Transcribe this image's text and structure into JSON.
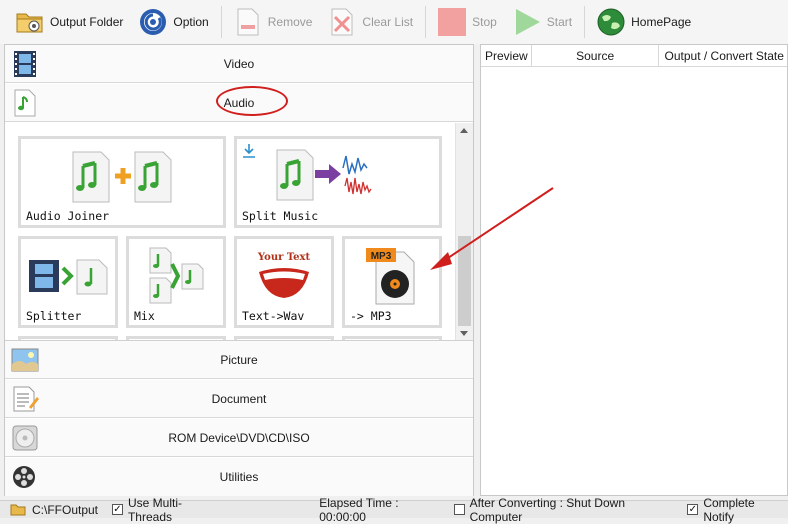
{
  "toolbar": {
    "output_folder": "Output Folder",
    "option": "Option",
    "remove": "Remove",
    "clear_list": "Clear List",
    "stop": "Stop",
    "start": "Start",
    "homepage": "HomePage"
  },
  "categories": {
    "video": "Video",
    "audio": "Audio",
    "picture": "Picture",
    "document": "Document",
    "rom": "ROM Device\\DVD\\CD\\ISO",
    "utilities": "Utilities"
  },
  "tiles": {
    "audio_joiner": "Audio Joiner",
    "split_music": "Split Music",
    "splitter": "Splitter",
    "mix": "Mix",
    "text_wav": "Text->Wav",
    "to_mp3": "-> MP3",
    "mp3_badge": "MP3",
    "your_text": "Your Text"
  },
  "list": {
    "columns": [
      "Preview",
      "Source",
      "Output / Convert State"
    ]
  },
  "status": {
    "output_path": "C:\\FFOutput",
    "multi_threads": "Use Multi-Threads",
    "multi_threads_checked": true,
    "elapsed": "Elapsed Time : 00:00:00",
    "after_converting": "After Converting : Shut Down Computer",
    "after_converting_checked": false,
    "complete_notify": "Complete Notify",
    "complete_notify_checked": true
  },
  "colors": {
    "annotation": "#d0201e",
    "music_green": "#3aa335",
    "stop_red": "#f2a0a0",
    "start_green": "#9fd89a"
  }
}
